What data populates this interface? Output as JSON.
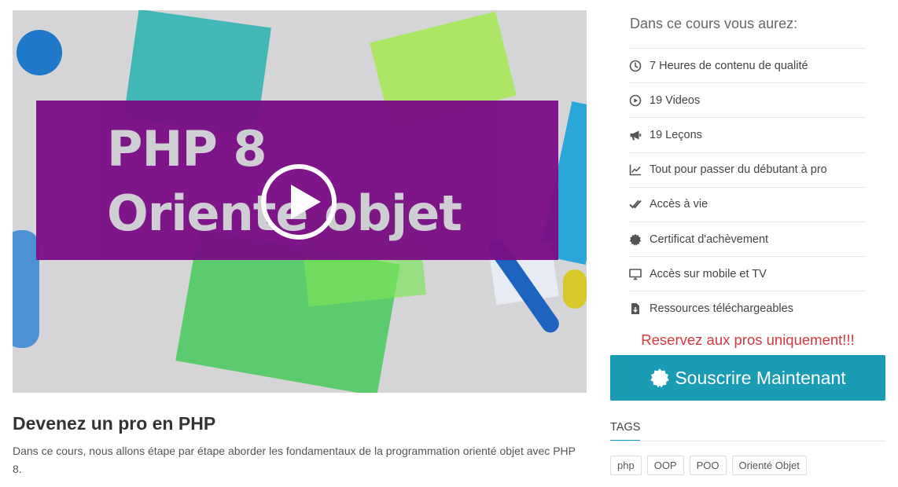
{
  "video": {
    "thumbnail_line1": "PHP 8",
    "thumbnail_line2": "Oriente objet"
  },
  "course": {
    "title": "Devenez un pro en PHP",
    "description": "Dans ce cours, nous allons étape par étape aborder les fondamentaux de la programmation orienté objet avec PHP 8."
  },
  "sidebar": {
    "heading": "Dans ce cours vous aurez:",
    "features": [
      {
        "icon": "clock-icon",
        "label": "7 Heures de contenu de qualité"
      },
      {
        "icon": "play-circle-icon",
        "label": "19 Videos"
      },
      {
        "icon": "megaphone-icon",
        "label": "19 Leçons"
      },
      {
        "icon": "chart-line-icon",
        "label": "Tout pour passer du débutant à pro"
      },
      {
        "icon": "double-check-icon",
        "label": "Accès à vie"
      },
      {
        "icon": "certificate-icon",
        "label": "Certificat d'achèvement"
      },
      {
        "icon": "desktop-icon",
        "label": "Accès sur mobile et TV"
      },
      {
        "icon": "file-download-icon",
        "label": "Ressources téléchargeables"
      }
    ],
    "promo": "Reservez aux pros uniquement!!!",
    "subscribe_label": "Souscrire Maintenant",
    "tags_title": "TAGS",
    "tags": [
      "php",
      "OOP",
      "POO",
      "Orienté Objet"
    ]
  },
  "colors": {
    "accent": "#1a9cb5",
    "promo": "#d9383a",
    "banner": "#7b0f86"
  }
}
